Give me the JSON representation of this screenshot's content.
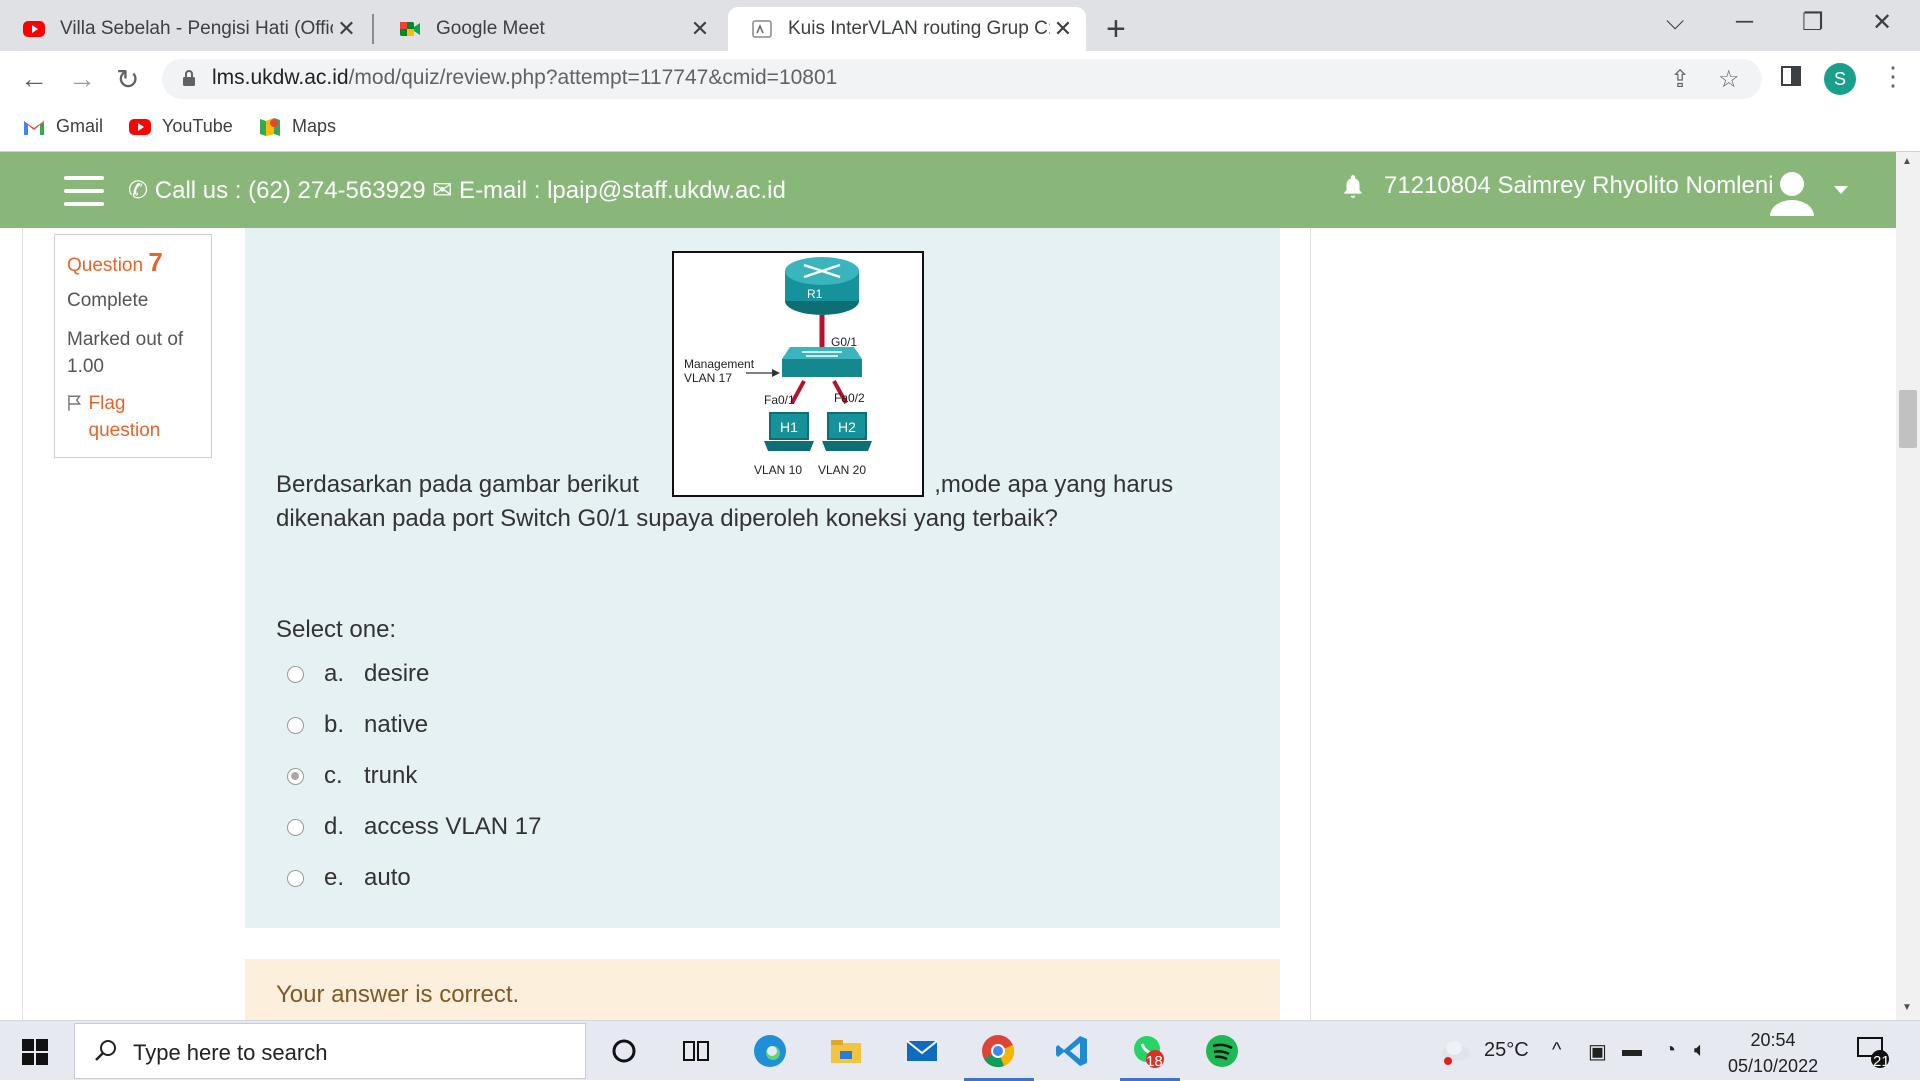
{
  "browser": {
    "tabs": [
      {
        "title": "Villa Sebelah - Pengisi Hati (Offici",
        "icon": "youtube-icon"
      },
      {
        "title": "Google Meet",
        "icon": "google-meet-icon"
      },
      {
        "title": "Kuis InterVLAN routing Grup C: A",
        "icon": "moodle-icon"
      }
    ],
    "url_host": "lms.ukdw.ac.id",
    "url_path": "/mod/quiz/review.php?attempt=117747&cmid=10801",
    "profile_initial": "S",
    "bookmarks": [
      "Gmail",
      "YouTube",
      "Maps"
    ]
  },
  "header": {
    "contact": "Call us : (62) 274-563929 ✉ E-mail : lpaip@staff.ukdw.ac.id",
    "user": "71210804 Saimrey Rhyolito Nomleni"
  },
  "question_info": {
    "label": "Question",
    "number": "7",
    "state": "Complete",
    "grade": "Marked out of 1.00",
    "flag": "Flag question"
  },
  "question": {
    "text_before": "Berdasarkan pada gambar berikut",
    "text_after": ",mode apa yang harus dikenakan pada port Switch G0/1 supaya diperoleh koneksi yang terbaik?",
    "diagram": {
      "router": "R1",
      "uplink": "G0/1",
      "mgmt_line1": "Management",
      "mgmt_line2": "VLAN 17",
      "port1": "Fa0/1",
      "port2": "Fa0/2",
      "host1": "H1",
      "host2": "H2",
      "vlan1": "VLAN 10",
      "vlan2": "VLAN 20"
    },
    "select_label": "Select one:",
    "options": [
      {
        "letter": "a.",
        "text": "desire",
        "checked": false
      },
      {
        "letter": "b.",
        "text": "native",
        "checked": false
      },
      {
        "letter": "c.",
        "text": "trunk",
        "checked": true
      },
      {
        "letter": "d.",
        "text": "access VLAN 17",
        "checked": false
      },
      {
        "letter": "e.",
        "text": "auto",
        "checked": false
      }
    ],
    "feedback": "Your answer is correct."
  },
  "taskbar": {
    "search_placeholder": "Type here to search",
    "weather": "25°C",
    "time": "20:54",
    "date": "05/10/2022",
    "whatsapp_badge": "18",
    "notifications": "21"
  },
  "colors": {
    "header_green": "#88b779",
    "question_bg": "#e6f1f3",
    "feedback_bg": "#fcefdc",
    "accent_orange": "#e8632a"
  }
}
